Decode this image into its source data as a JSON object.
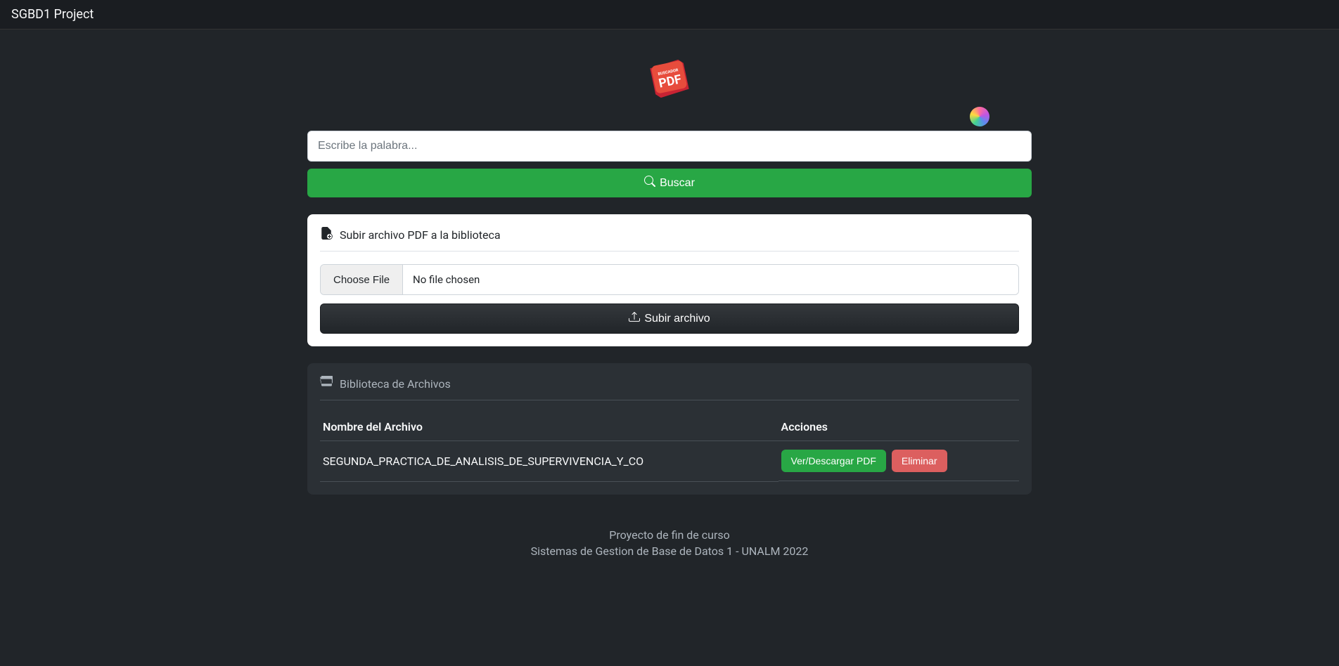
{
  "navbar": {
    "brand": "SGBD1 Project"
  },
  "logo": {
    "text_top": "BUSCADOR",
    "text_bottom": "PDF"
  },
  "search": {
    "placeholder": "Escribe la palabra...",
    "button_label": "Buscar"
  },
  "upload": {
    "title": "Subir archivo PDF a la biblioteca",
    "choose_label": "Choose File",
    "no_file_label": "No file chosen",
    "submit_label": "Subir archivo"
  },
  "library": {
    "title": "Biblioteca de Archivos",
    "columns": {
      "filename": "Nombre del Archivo",
      "actions": "Acciones"
    },
    "files": [
      {
        "name": "SEGUNDA_PRACTICA_DE_ANALISIS_DE_SUPERVIVENCIA_Y_CO",
        "view_label": "Ver/Descargar PDF",
        "delete_label": "Eliminar"
      }
    ]
  },
  "footer": {
    "line1": "Proyecto de fin de curso",
    "line2": "Sistemas de Gestion de Base de Datos 1 - UNALM 2022"
  }
}
